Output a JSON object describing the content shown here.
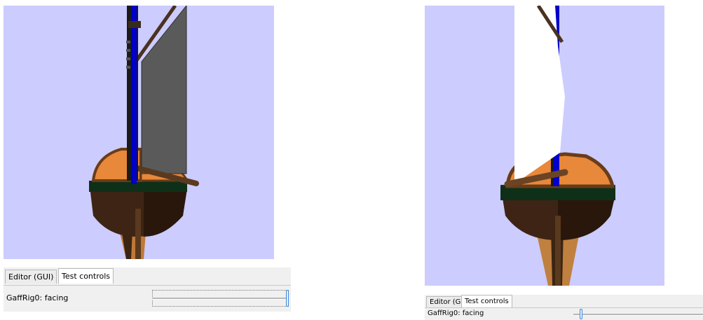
{
  "left": {
    "tabs": [
      {
        "label": "Editor (GUI)",
        "active": false
      },
      {
        "label": "Test controls",
        "active": true
      }
    ],
    "control": {
      "label": "GaffRig0:  facing",
      "slider_value": 1.0
    },
    "sail_color": "#5a5a5a"
  },
  "right": {
    "tabs": [
      {
        "label": "Editor (GUI)",
        "active": false
      },
      {
        "label": "Test controls",
        "active": true
      }
    ],
    "control": {
      "label": "GaffRig0:  facing",
      "slider_value": 0.05
    },
    "sail_color": "#ffffff"
  },
  "colors": {
    "sky": "#ccccff",
    "hull_dark": "#3a2010",
    "deck": "#e8883a",
    "waterline": "#0f3018",
    "mast": "#0000cc",
    "wood": "#5a3a1e"
  }
}
